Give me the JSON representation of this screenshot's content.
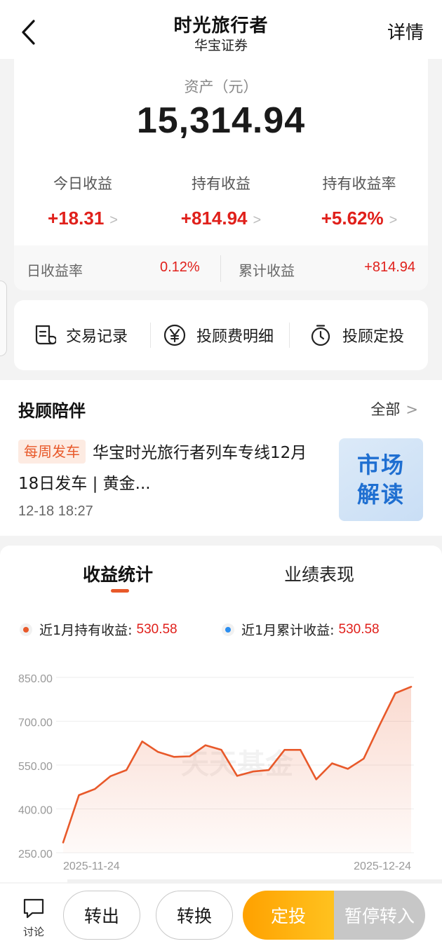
{
  "header": {
    "title": "时光旅行者",
    "subtitle": "华宝证券",
    "detail_label": "详情"
  },
  "asset": {
    "label": "资产（元）",
    "value": "15,314.94",
    "metrics": [
      {
        "label": "今日收益",
        "value": "+18.31"
      },
      {
        "label": "持有收益",
        "value": "+814.94"
      },
      {
        "label": "持有收益率",
        "value": "+5.62%"
      }
    ],
    "daily_rate_label": "日收益率",
    "daily_rate_value": "0.12%",
    "cumulative_label": "累计收益",
    "cumulative_value": "+814.94"
  },
  "actions": [
    {
      "label": "交易记录",
      "icon": "receipt-icon"
    },
    {
      "label": "投顾费明细",
      "icon": "yen-circle-icon"
    },
    {
      "label": "投顾定投",
      "icon": "stopwatch-icon"
    }
  ],
  "advisor": {
    "title": "投顾陪伴",
    "all_label": "全部",
    "tag": "每周发车",
    "headline": "华宝时光旅行者列车专线12月18日发车 | 黄金...",
    "time": "12-18 18:27",
    "thumb_line1": "市场",
    "thumb_line2": "解读"
  },
  "stats": {
    "tabs": [
      "收益统计",
      "业绩表现"
    ],
    "active_tab": 0,
    "legend": [
      {
        "label": "近1月持有收益:",
        "value": "530.58",
        "color": "#e8592a"
      },
      {
        "label": "近1月累计收益:",
        "value": "530.58",
        "color": "#2b8ef0"
      }
    ],
    "watermark": "天天基金"
  },
  "chart_data": {
    "type": "area",
    "x_start": "2025-11-24",
    "x_end": "2025-12-24",
    "x_tick_labels": [
      "2025-11-24",
      "2025-12-24"
    ],
    "y_tick_labels": [
      "850.00",
      "700.00",
      "550.00",
      "400.00",
      "250.00"
    ],
    "ylim": [
      250,
      850
    ],
    "color": "#e8592a",
    "values": [
      285,
      447,
      468,
      512,
      533,
      631,
      595,
      578,
      580,
      618,
      602,
      513,
      528,
      533,
      602,
      602,
      501,
      556,
      537,
      572,
      686,
      796,
      818
    ]
  },
  "bottombar": {
    "discuss_label": "讨论",
    "transfer_out": "转出",
    "convert": "转换",
    "sip": "定投",
    "pause": "暂停转入"
  }
}
